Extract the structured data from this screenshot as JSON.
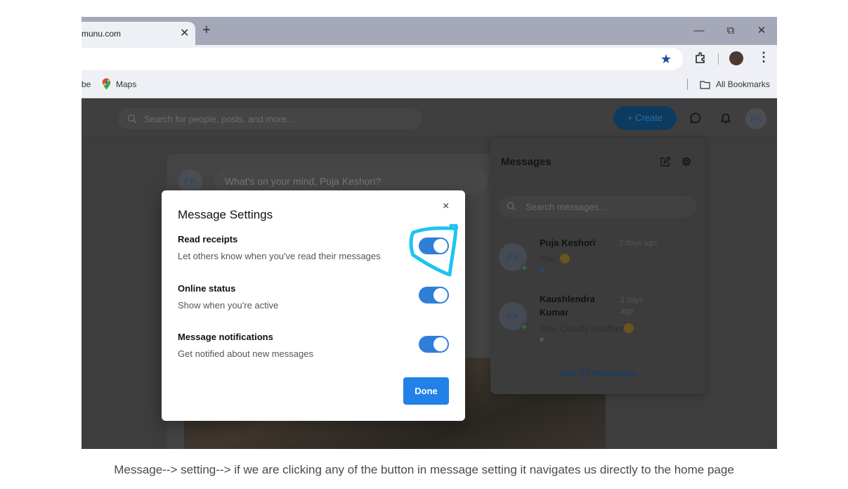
{
  "browser": {
    "tab_title": "munu.com",
    "tab_close": "✕",
    "new_tab": "+",
    "window_controls": {
      "minimize": "—",
      "restore": "⧉",
      "close": "✕"
    },
    "bookmarks": {
      "item1": "be",
      "maps": "Maps",
      "all_bookmarks": "All Bookmarks"
    }
  },
  "app": {
    "search_placeholder": "Search for people, posts, and more...",
    "create_label": "+  Create",
    "avatar_initials": "PK",
    "composer_avatar": "PK",
    "composer_placeholder": "What's on your mind, Puja Keshori?"
  },
  "messages_panel": {
    "title": "Messages",
    "search_placeholder": "Search messages...",
    "conversations": [
      {
        "initials": "PK",
        "name": "Puja Keshori",
        "time": "2 days ago",
        "preview": "You: ",
        "unread_color": "#26466d"
      },
      {
        "initials": "KK",
        "name": "Kaushlendra Kumar",
        "time": "2 days ago",
        "preview": "You: Cloudy weather",
        "unread_color": "#555555"
      }
    ],
    "see_all": "See All Messages"
  },
  "modal": {
    "title": "Message Settings",
    "close": "×",
    "settings": [
      {
        "label": "Read receipts",
        "description": "Let others know when you've read their messages",
        "enabled": true
      },
      {
        "label": "Online status",
        "description": "Show when you're active",
        "enabled": true
      },
      {
        "label": "Message notifications",
        "description": "Get notified about new messages",
        "enabled": true
      }
    ],
    "done": "Done"
  },
  "colors": {
    "accent": "#2281e6",
    "highlight": "#1ec4f0"
  },
  "caption": "Message--> setting--> if we are clicking any of the button in message setting it navigates us directly to the home page"
}
